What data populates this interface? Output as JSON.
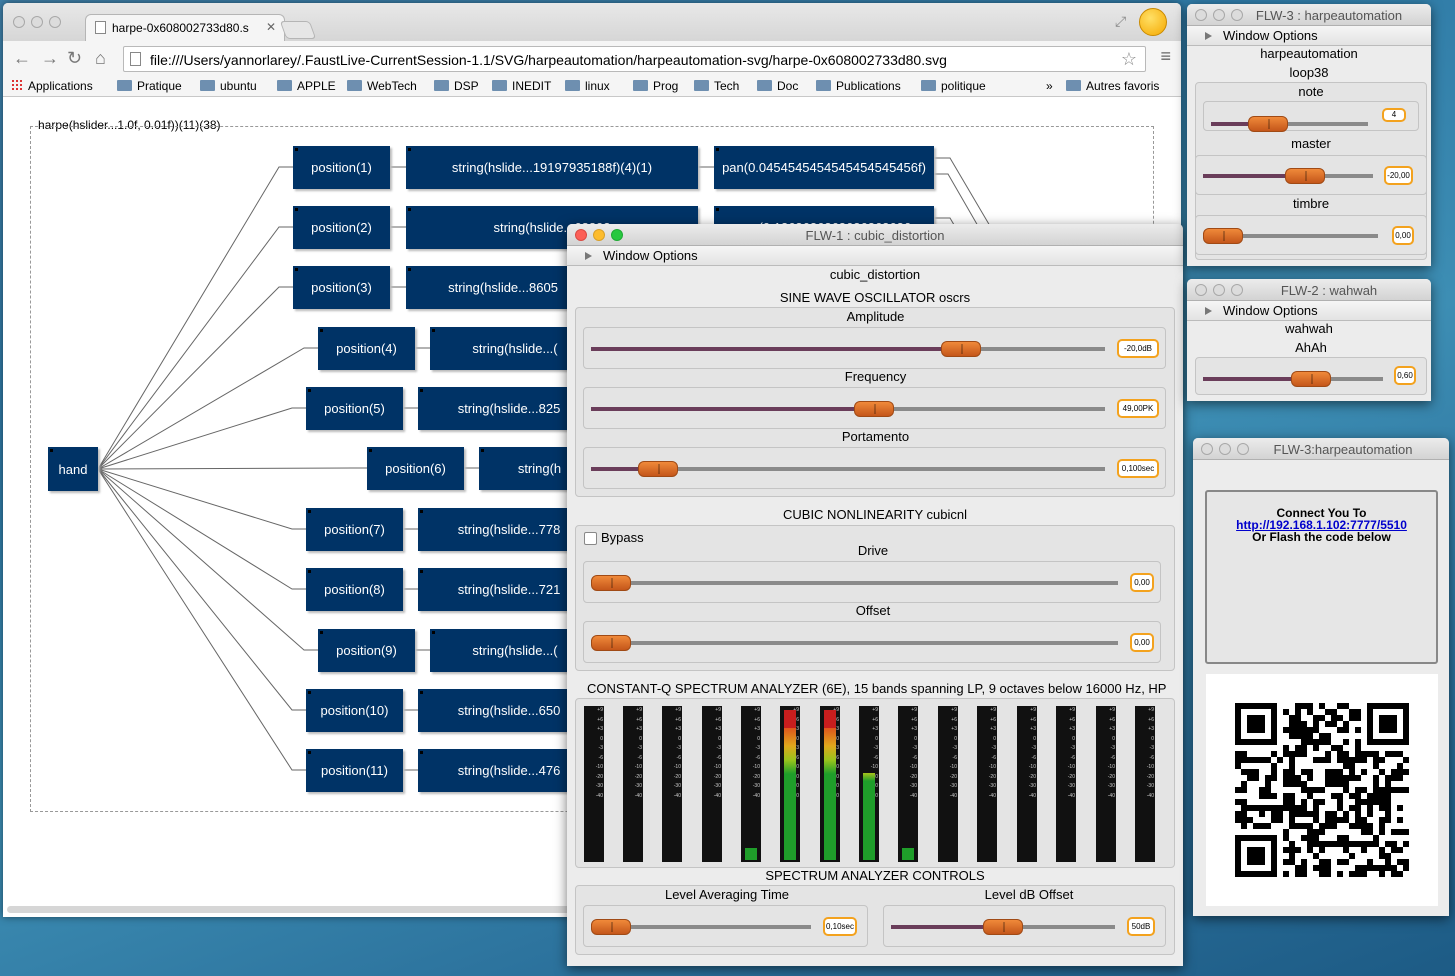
{
  "browser": {
    "tab_title": "harpe-0x608002733d80.s",
    "url": "file:///Users/yannorlarey/.FaustLive-CurrentSession-1.1/SVG/harpeautomation/harpeautomation-svg/harpe-0x608002733d80.svg",
    "bookmarks": [
      "Applications",
      "Pratique",
      "ubuntu",
      "APPLE",
      "WebTech",
      "DSP",
      "INEDIT",
      "linux",
      "Prog",
      "Tech",
      "Doc",
      "Publications",
      "politique"
    ],
    "bookmarks_more": "»",
    "other_bookmarks": "Autres favoris"
  },
  "diagram": {
    "title": "harpe(hslider...1.0f, 0.01f))(11)(38)",
    "hand": "hand",
    "positions": [
      "position(1)",
      "position(2)",
      "position(3)",
      "position(4)",
      "position(5)",
      "position(6)",
      "position(7)",
      "position(8)",
      "position(9)",
      "position(10)",
      "position(11)"
    ],
    "strings": [
      "string(hslide...19197935188f)(4)(1)",
      "string(hslide...68892",
      "string(hslide...8605",
      "string(hslide...(",
      "string(hslide...825",
      "string(h",
      "string(hslide...778",
      "string(hslide...721",
      "string(hslide...(",
      "string(hslide...650",
      "string(hslide...476"
    ],
    "pans": [
      "pan(0.0454545454545454545456f)",
      "pan(0.1363636363636363636"
    ]
  },
  "flw1": {
    "title": "FLW-1 : cubic_distortion",
    "options": "Window Options",
    "name": "cubic_distortion",
    "osc_group": "SINE WAVE OSCILLATOR oscrs",
    "amplitude_label": "Amplitude",
    "amplitude_value": "-20,0dB",
    "amplitude_level": 0.72,
    "frequency_label": "Frequency",
    "frequency_value": "49,00PK",
    "frequency_level": 0.55,
    "portamento_label": "Portamento",
    "portamento_value": "0,100sec",
    "portamento_level": 0.13,
    "cubic_group": "CUBIC NONLINEARITY cubicnl",
    "bypass_label": "Bypass",
    "drive_label": "Drive",
    "drive_value": "0,00",
    "drive_level": 0.0,
    "offset_label": "Offset",
    "offset_value": "0,00",
    "offset_level": 0.0,
    "spectrum_group": "CONSTANT-Q SPECTRUM ANALYZER (6E), 15 bands spanning LP, 9 octaves below 16000 Hz, HP",
    "meter_ticks": [
      "+9",
      "+6",
      "+3",
      "0",
      "-3",
      "-6",
      "-10",
      "-20",
      "-30",
      "-40"
    ],
    "meter_levels": [
      0,
      0,
      0,
      0,
      0.08,
      1.0,
      1.0,
      0.58,
      0.08,
      0,
      0,
      0,
      0,
      0,
      0
    ],
    "controls_group": "SPECTRUM ANALYZER CONTROLS",
    "avg_label": "Level Averaging Time",
    "avg_value": "0,10sec",
    "avg_level": 0.09,
    "dboff_label": "Level dB Offset",
    "dboff_value": "50dB",
    "dboff_level": 0.5
  },
  "flw3": {
    "title": "FLW-3 : harpeautomation",
    "options": "Window Options",
    "name": "harpeautomation",
    "loop": "loop38",
    "note_label": "note",
    "note_value": "4",
    "note_level": 0.36,
    "master_label": "master",
    "master_value": "-20,00",
    "master_level": 0.6,
    "timbre_label": "timbre",
    "timbre_value": "0,00",
    "timbre_level": 0.0
  },
  "flw2": {
    "title": "FLW-2 : wahwah",
    "options": "Window Options",
    "name": "wahwah",
    "ahah_label": "AhAh",
    "ahah_value": "0,60",
    "ahah_level": 0.6
  },
  "flw3b": {
    "title": "FLW-3:harpeautomation",
    "connect": "Connect You To",
    "link": "http://192.168.1.102:7777/5510",
    "flash": "Or Flash the code below"
  }
}
